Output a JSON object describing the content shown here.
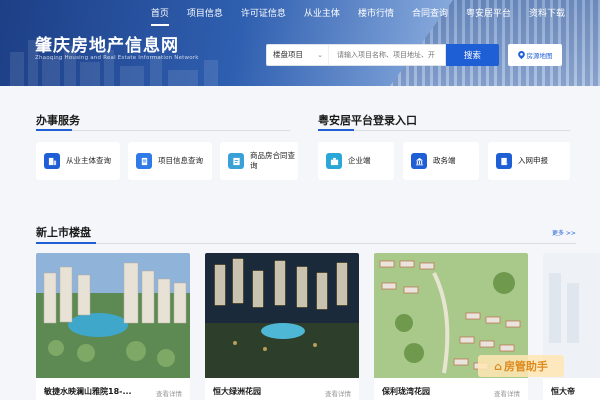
{
  "site": {
    "title": "肇庆房地产信息网",
    "subtitle": "Zhaoqing Housing and Real Estate Information Network"
  },
  "nav": [
    "首页",
    "项目信息",
    "许可证信息",
    "从业主体",
    "楼市行情",
    "合同查询",
    "粤安居平台",
    "资料下载"
  ],
  "search": {
    "select_value": "楼盘项目",
    "placeholder": "请输入项目名称、项目地址、开",
    "button": "搜索",
    "map_button": "房源地图"
  },
  "services": {
    "title": "办事服务",
    "items": [
      "从业主体查询",
      "项目信息查询",
      "商品房合同查询"
    ]
  },
  "platform": {
    "title": "粤安居平台登录入口",
    "items": [
      "企业端",
      "政务端",
      "入网申报"
    ]
  },
  "listings": {
    "title": "新上市楼盘",
    "more": "更多 >>",
    "cards": [
      {
        "name": "敏捷水映澜山雅院18-...",
        "detail": "查看详情"
      },
      {
        "name": "恒大绿洲花园",
        "detail": "查看详情"
      },
      {
        "name": "保利珑湾花园",
        "detail": "查看详情"
      },
      {
        "name": "恒大帝",
        "detail": ""
      }
    ]
  },
  "watermark": "房管助手",
  "colors": {
    "primary": "#1f5fd6",
    "hero_dark": "#1d3f86",
    "accent_orange": "#e08a1e"
  }
}
